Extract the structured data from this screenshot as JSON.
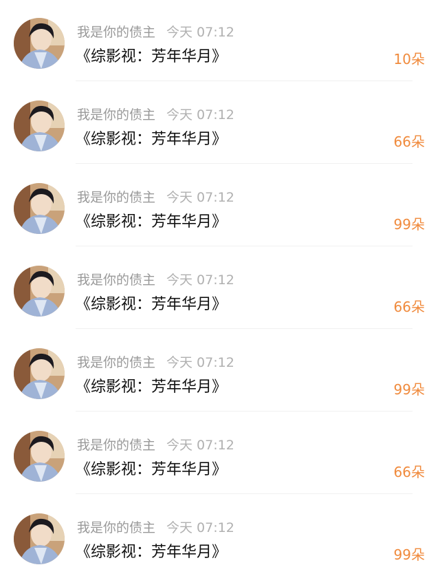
{
  "items": [
    {
      "user": "我是你的债主",
      "time": "今天 07:12",
      "title": "《综影视：芳年华月》",
      "count": "10朵"
    },
    {
      "user": "我是你的债主",
      "time": "今天 07:12",
      "title": "《综影视：芳年华月》",
      "count": "66朵"
    },
    {
      "user": "我是你的债主",
      "time": "今天 07:12",
      "title": "《综影视：芳年华月》",
      "count": "99朵"
    },
    {
      "user": "我是你的债主",
      "time": "今天 07:12",
      "title": "《综影视：芳年华月》",
      "count": "66朵"
    },
    {
      "user": "我是你的债主",
      "time": "今天 07:12",
      "title": "《综影视：芳年华月》",
      "count": "99朵"
    },
    {
      "user": "我是你的债主",
      "time": "今天 07:12",
      "title": "《综影视：芳年华月》",
      "count": "66朵"
    },
    {
      "user": "我是你的债主",
      "time": "今天 07:12",
      "title": "《综影视：芳年华月》",
      "count": "99朵"
    }
  ],
  "colors": {
    "count_accent": "#f08a3c",
    "meta_text": "#999999",
    "title_text": "#111111"
  },
  "avatar_icon": "user-avatar-photo"
}
